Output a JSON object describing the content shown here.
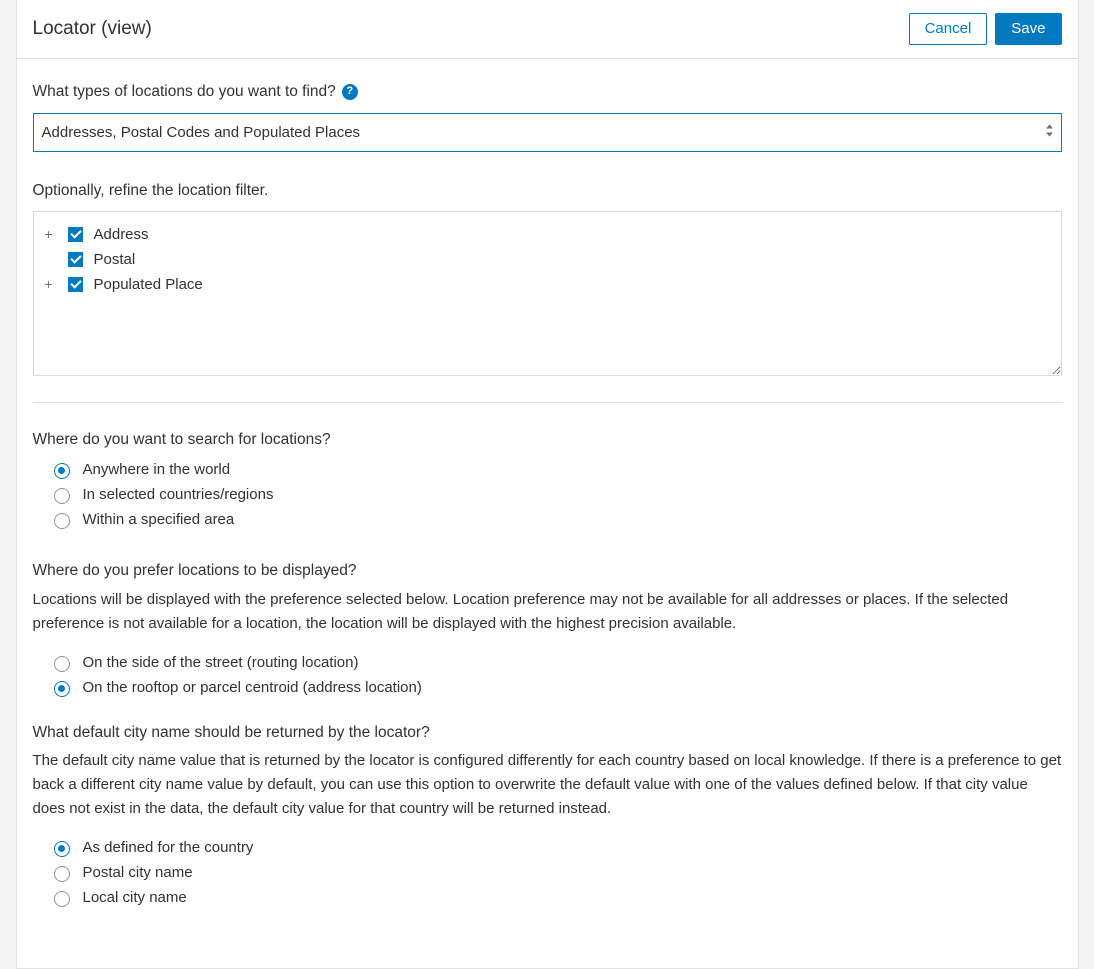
{
  "header": {
    "title": "Locator (view)",
    "cancel_label": "Cancel",
    "save_label": "Save"
  },
  "location_types": {
    "question": "What types of locations do you want to find?",
    "selected": "Addresses, Postal Codes and Populated Places"
  },
  "refine": {
    "label": "Optionally, refine the location filter.",
    "items": [
      {
        "label": "Address",
        "checked": true,
        "expandable": true
      },
      {
        "label": "Postal",
        "checked": true,
        "expandable": false
      },
      {
        "label": "Populated Place",
        "checked": true,
        "expandable": true
      }
    ]
  },
  "search_scope": {
    "question": "Where do you want to search for locations?",
    "options": [
      {
        "label": "Anywhere in the world",
        "selected": true
      },
      {
        "label": "In selected countries/regions",
        "selected": false
      },
      {
        "label": "Within a specified area",
        "selected": false
      }
    ]
  },
  "display_pref": {
    "question": "Where do you prefer locations to be displayed?",
    "description": "Locations will be displayed with the preference selected below. Location preference may not be available for all addresses or places. If the selected preference is not available for a location, the location will be displayed with the highest precision available.",
    "options": [
      {
        "label": "On the side of the street (routing location)",
        "selected": false
      },
      {
        "label": "On the rooftop or parcel centroid (address location)",
        "selected": true
      }
    ]
  },
  "city_name": {
    "question": "What default city name should be returned by the locator?",
    "description": "The default city name value that is returned by the locator is configured differently for each country based on local knowledge. If there is a preference to get back a different city name value by default, you can use this option to overwrite the default value with one of the values defined below. If that city value does not exist in the data, the default city value for that country will be returned instead.",
    "options": [
      {
        "label": "As defined for the country",
        "selected": true
      },
      {
        "label": "Postal city name",
        "selected": false
      },
      {
        "label": "Local city name",
        "selected": false
      }
    ]
  }
}
